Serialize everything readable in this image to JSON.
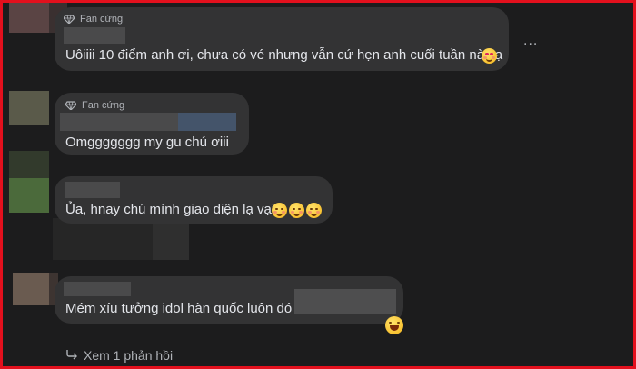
{
  "colors": {
    "background": "#1c1c1d",
    "bubble": "#333334",
    "text": "#e4e6eb",
    "muted": "#b0b3b8",
    "frame": "#e3101d"
  },
  "comments": [
    {
      "badge": "Fan cứng",
      "text": "Uôiiii 10 điểm anh ơi, chưa có vé nhưng vẫn cứ hẹn anh cuối tuần này ạ"
    },
    {
      "badge": "Fan cứng",
      "text": "Omggggggg my gu chú ơiii"
    },
    {
      "text": "Ủa, hnay chú mình giao diện lạ vại"
    },
    {
      "text": "Mém xíu tưởng idol hàn quốc luôn đó"
    }
  ],
  "more_label": "...",
  "reply_link": "Xem 1 phản hồi",
  "icons": {
    "badge": "diamond-icon",
    "more": "more-options-icon",
    "reply": "reply-arrow-icon"
  }
}
